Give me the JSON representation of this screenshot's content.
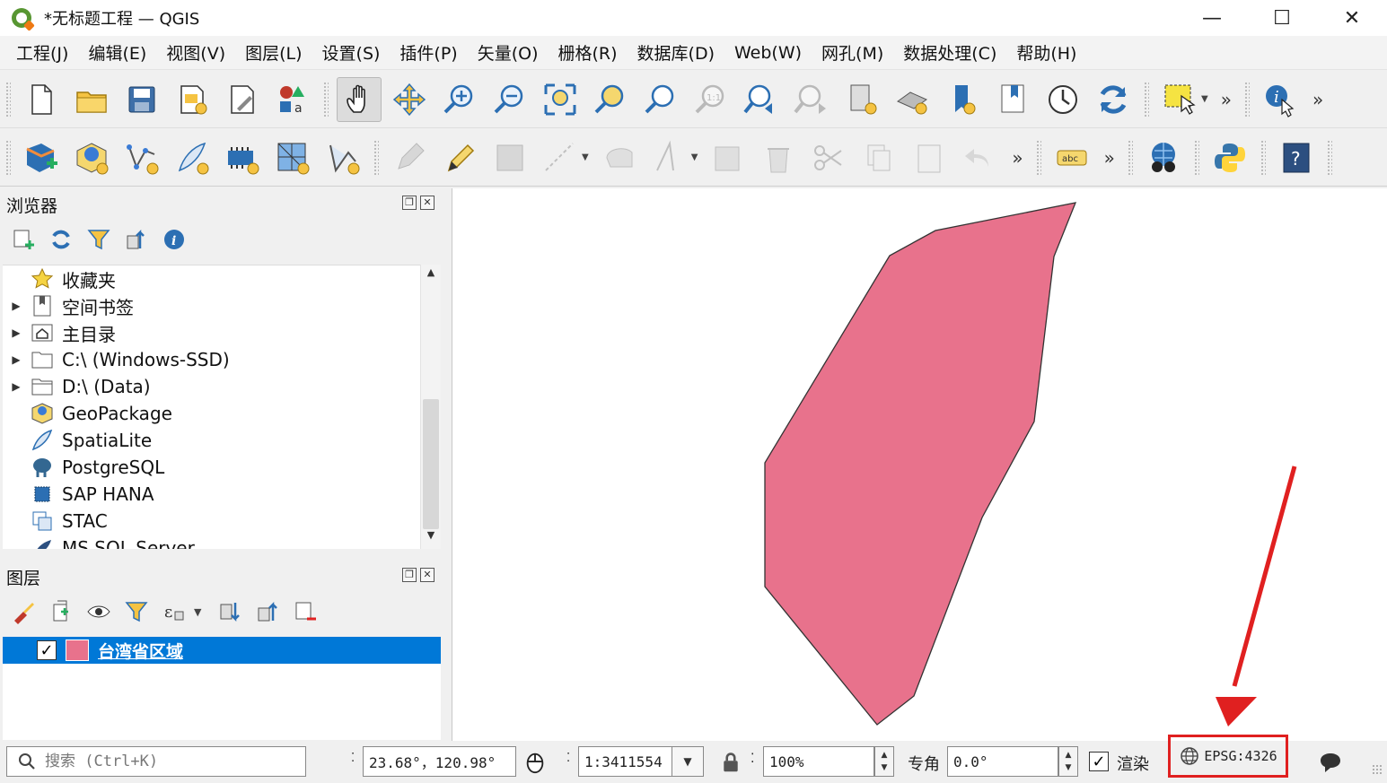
{
  "window": {
    "title": "*无标题工程 — QGIS",
    "minimize": "—",
    "maximize": "☐",
    "close": "✕"
  },
  "menu": [
    "工程(J)",
    "编辑(E)",
    "视图(V)",
    "图层(L)",
    "设置(S)",
    "插件(P)",
    "矢量(O)",
    "栅格(R)",
    "数据库(D)",
    "Web(W)",
    "网孔(M)",
    "数据处理(C)",
    "帮助(H)"
  ],
  "browser": {
    "title": "浏览器",
    "items": [
      {
        "label": "收藏夹",
        "icon": "star-icon",
        "expandable": false
      },
      {
        "label": "空间书签",
        "icon": "bookmark-icon",
        "expandable": true
      },
      {
        "label": "主目录",
        "icon": "home-folder-icon",
        "expandable": true
      },
      {
        "label": "C:\\ (Windows-SSD)",
        "icon": "drive-folder-icon",
        "expandable": true
      },
      {
        "label": "D:\\ (Data)",
        "icon": "drive-folder-icon",
        "expandable": true
      },
      {
        "label": "GeoPackage",
        "icon": "geopackage-icon",
        "expandable": false
      },
      {
        "label": "SpatiaLite",
        "icon": "spatialite-feather-icon",
        "expandable": false
      },
      {
        "label": "PostgreSQL",
        "icon": "postgresql-elephant-icon",
        "expandable": false
      },
      {
        "label": "SAP HANA",
        "icon": "sap-hana-icon",
        "expandable": false
      },
      {
        "label": "STAC",
        "icon": "stac-icon",
        "expandable": false
      },
      {
        "label": "MS SQL Server",
        "icon": "mssql-icon",
        "expandable": false
      }
    ]
  },
  "layers": {
    "title": "图层",
    "items": [
      {
        "name": "台湾省区域",
        "checked": true,
        "color": "#e8728c"
      }
    ]
  },
  "status": {
    "search_placeholder": "搜索 (Ctrl+K)",
    "coordinate": "23.68°，120.98°",
    "scale": "1:3411554",
    "magnifier": "100%",
    "rotation_label": "专角",
    "rotation": "0.0°",
    "render_label": "渲染",
    "render_checked": true,
    "crs": "EPSG:4326"
  },
  "colors": {
    "polygon_fill": "#e8728c",
    "selection": "#0078d7",
    "annotation": "#e02020"
  }
}
